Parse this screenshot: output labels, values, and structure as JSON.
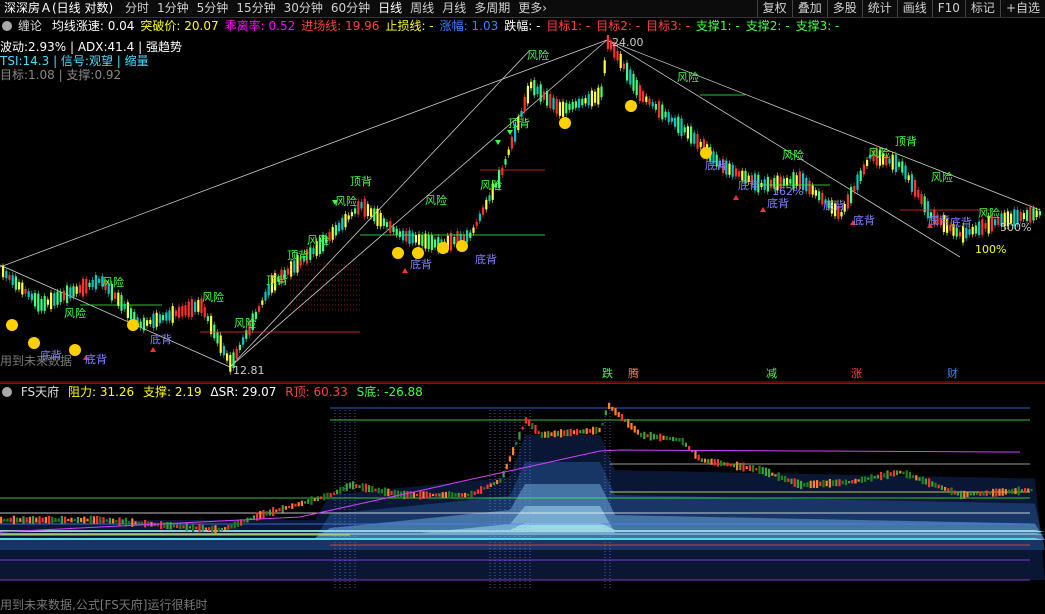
{
  "topbar": {
    "stock_title": "深深房Ａ(日线 对数)",
    "periods": [
      "分时",
      "1分钟",
      "5分钟",
      "15分钟",
      "30分钟",
      "60分钟",
      "日线",
      "周线",
      "月线",
      "多周期",
      "更多›"
    ],
    "active_period": "日线",
    "right_buttons": [
      "复权",
      "叠加",
      "多股",
      "统计",
      "画线",
      "F10",
      "标记",
      "+自选"
    ]
  },
  "infobar": {
    "chanlun": "缠论",
    "items": [
      {
        "label": "均线涨速: 0.04",
        "color": "#ffffff"
      },
      {
        "label": "突破价: 20.07",
        "color": "#ffff00"
      },
      {
        "label": "乖离率: 0.52",
        "color": "#ff00ff"
      },
      {
        "label": "进场线: 19.96",
        "color": "#ff4040"
      },
      {
        "label": "止损线: -",
        "color": "#ffff00"
      },
      {
        "label": "涨幅: 1.03",
        "color": "#4080ff"
      },
      {
        "label": "跌幅: -",
        "color": "#ffffff"
      },
      {
        "label": "目标1: -",
        "color": "#ff4040"
      },
      {
        "label": "目标2: -",
        "color": "#ff4040"
      },
      {
        "label": "目标3: -",
        "color": "#ff4040"
      },
      {
        "label": "支撑1: -",
        "color": "#40ff40"
      },
      {
        "label": "支撑2: -",
        "color": "#40ff40"
      },
      {
        "label": "支撑3: -",
        "color": "#40ff40"
      }
    ]
  },
  "overlay": {
    "line1": "波动:2.93% | ADX:41.4 | 强趋势",
    "line2": "TSI:14.3 | 信号:观望 | 缩量",
    "line3": "目标:1.08 | 支撑:0.92",
    "high_price": "24.00",
    "low_price": "12.81",
    "pct_162": "162%",
    "pct_100": "100%",
    "pct_500": "500%",
    "future_note": "用到未来数据",
    "risk": "风险",
    "top_div": "顶背",
    "bottom_div": "底背",
    "bottom_chars": [
      "跌",
      "腾",
      "减",
      "涨",
      "财"
    ]
  },
  "indicator": {
    "name": "FS天府",
    "resistance": "阻力: 31.26",
    "support": "支撑: 2.19",
    "dsr": "ΔSR: 29.07",
    "r_top": "R顶: 60.33",
    "s_bottom": "S底: -26.88"
  },
  "footer_note": "用到未来数据,公式[FS天府]运行很耗时",
  "colors": {
    "up": "#ff3030",
    "down": "#00c8c8",
    "risk": "#40ff40",
    "div": "#8080ff"
  }
}
